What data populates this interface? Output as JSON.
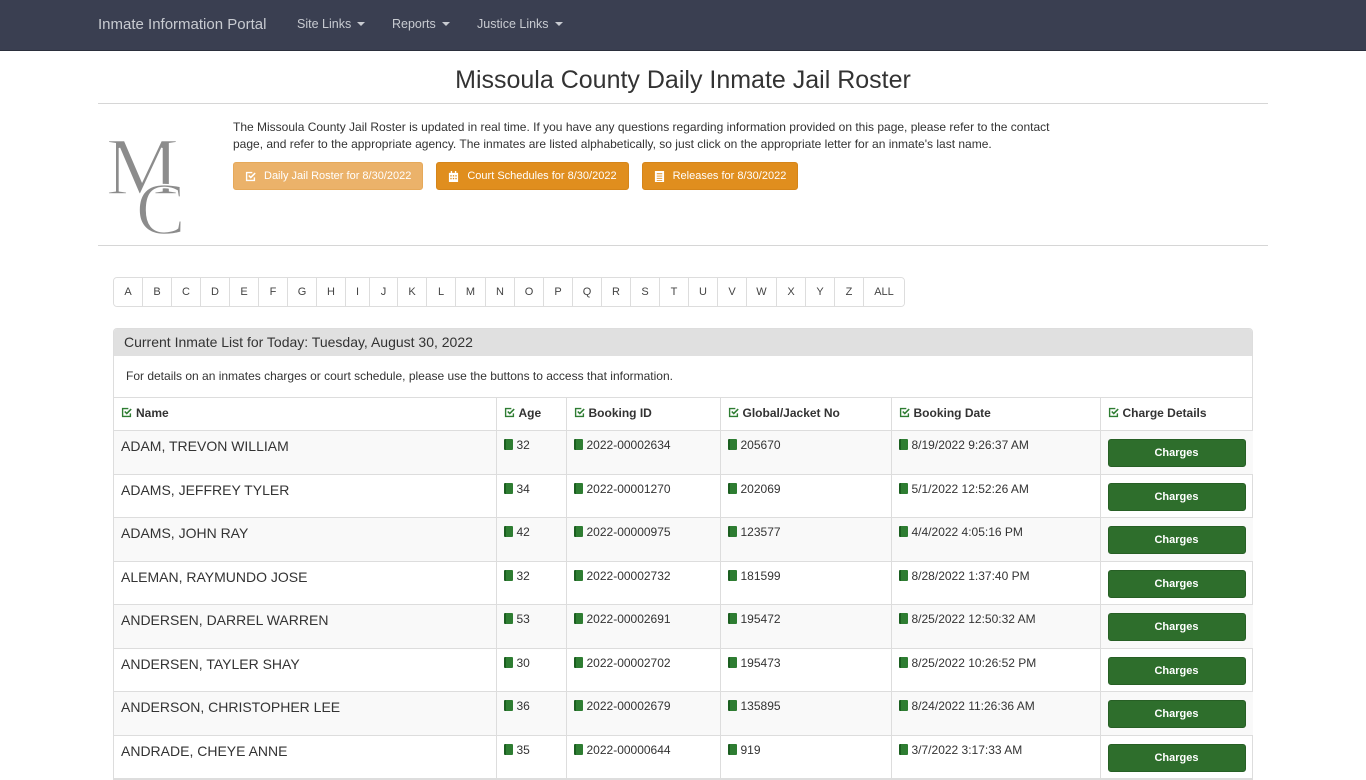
{
  "navbar": {
    "brand": "Inmate Information Portal",
    "items": [
      {
        "label": "Site Links"
      },
      {
        "label": "Reports"
      },
      {
        "label": "Justice Links"
      }
    ]
  },
  "page": {
    "title": "Missoula County Daily Inmate Jail Roster",
    "logo_text": "MC",
    "intro": "The Missoula County Jail Roster is updated in real time. If you have any questions regarding information provided on this page, please refer to the contact page, and refer to the appropriate agency. The inmates are listed alphabetically, so just click on the appropriate letter for an inmate's last name.",
    "buttons": [
      {
        "label": "Daily Jail Roster for 8/30/2022",
        "icon": "check-square-icon",
        "state": "disabled"
      },
      {
        "label": "Court Schedules for 8/30/2022",
        "icon": "calendar-icon",
        "state": "active"
      },
      {
        "label": "Releases for 8/30/2022",
        "icon": "list-icon",
        "state": "active"
      }
    ]
  },
  "alphabet": [
    "A",
    "B",
    "C",
    "D",
    "E",
    "F",
    "G",
    "H",
    "I",
    "J",
    "K",
    "L",
    "M",
    "N",
    "O",
    "P",
    "Q",
    "R",
    "S",
    "T",
    "U",
    "V",
    "W",
    "X",
    "Y",
    "Z",
    "ALL"
  ],
  "panel": {
    "heading": "Current Inmate List for Today: Tuesday, August 30, 2022",
    "note": "For details on an inmates charges or court schedule, please use the buttons to access that information."
  },
  "table": {
    "columns": [
      "Name",
      "Age",
      "Booking ID",
      "Global/Jacket No",
      "Booking Date",
      "Charge Details"
    ],
    "button_label": "Charges",
    "rows": [
      {
        "name": "ADAM, TREVON WILLIAM",
        "age": "32",
        "booking_id": "2022-00002634",
        "jacket": "205670",
        "date": "8/19/2022 9:26:37 AM"
      },
      {
        "name": "ADAMS, JEFFREY TYLER",
        "age": "34",
        "booking_id": "2022-00001270",
        "jacket": "202069",
        "date": "5/1/2022 12:52:26 AM"
      },
      {
        "name": "ADAMS, JOHN RAY",
        "age": "42",
        "booking_id": "2022-00000975",
        "jacket": "123577",
        "date": "4/4/2022 4:05:16 PM"
      },
      {
        "name": "ALEMAN, RAYMUNDO JOSE",
        "age": "32",
        "booking_id": "2022-00002732",
        "jacket": "181599",
        "date": "8/28/2022 1:37:40 PM"
      },
      {
        "name": "ANDERSEN, DARREL WARREN",
        "age": "53",
        "booking_id": "2022-00002691",
        "jacket": "195472",
        "date": "8/25/2022 12:50:32 AM"
      },
      {
        "name": "ANDERSEN, TAYLER SHAY",
        "age": "30",
        "booking_id": "2022-00002702",
        "jacket": "195473",
        "date": "8/25/2022 10:26:52 PM"
      },
      {
        "name": "ANDERSON, CHRISTOPHER LEE",
        "age": "36",
        "booking_id": "2022-00002679",
        "jacket": "135895",
        "date": "8/24/2022 11:26:36 AM"
      },
      {
        "name": "ANDRADE, CHEYE ANNE",
        "age": "35",
        "booking_id": "2022-00000644",
        "jacket": "919",
        "date": "3/7/2022 3:17:33 AM"
      }
    ]
  },
  "colors": {
    "navbar": "#3a3f51",
    "orange_button": "#e08e1e",
    "orange_button_disabled": "#ebb26a",
    "green_button": "#2e6e2c",
    "icon_green": "#2e7d32"
  }
}
